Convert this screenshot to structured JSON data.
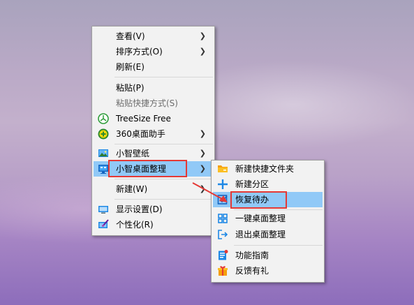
{
  "context_menu": {
    "items": [
      {
        "label": "查看(V)"
      },
      {
        "label": "排序方式(O)"
      },
      {
        "label": "刷新(E)"
      },
      {
        "label": "粘贴(P)"
      },
      {
        "label": "粘贴快捷方式(S)"
      },
      {
        "label": "TreeSize Free"
      },
      {
        "label": "360桌面助手"
      },
      {
        "label": "小智壁纸"
      },
      {
        "label": "小智桌面整理"
      },
      {
        "label": "新建(W)"
      },
      {
        "label": "显示设置(D)"
      },
      {
        "label": "个性化(R)"
      }
    ]
  },
  "submenu": {
    "items": [
      {
        "label": "新建快捷文件夹"
      },
      {
        "label": "新建分区"
      },
      {
        "label": "恢复待办"
      },
      {
        "label": "一键桌面整理"
      },
      {
        "label": "退出桌面整理"
      },
      {
        "label": "功能指南"
      },
      {
        "label": "反馈有礼"
      }
    ]
  },
  "icons": {
    "treesize": "treesize-icon",
    "360": "360-icon",
    "wallpaper": "wallpaper-icon",
    "desktop_organizer": "desktop-monitor-icon",
    "display": "display-icon",
    "personalize": "personalize-icon",
    "folder": "folder-icon",
    "plus": "plus-icon",
    "todo": "todo-icon",
    "grid": "grid-icon",
    "exit": "exit-icon",
    "guide": "guide-icon",
    "gift": "gift-icon"
  },
  "colors": {
    "highlight": "#91c9f7",
    "annotation": "#e53935",
    "accent_blue": "#1e88e5",
    "accent_orange": "#f59e0b"
  }
}
